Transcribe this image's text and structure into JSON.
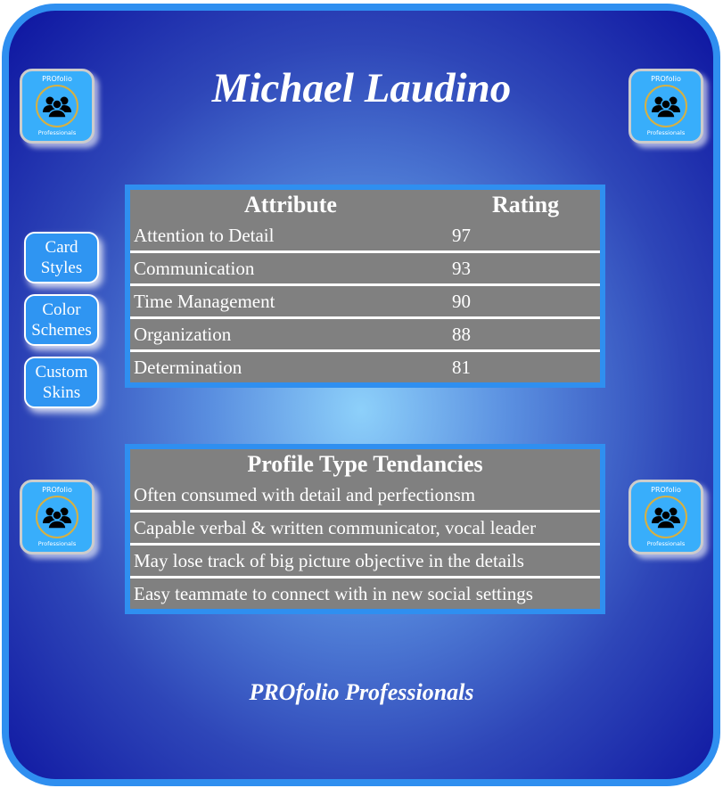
{
  "title": "Michael Laudino",
  "footer": "PROfolio Professionals",
  "logo": {
    "top": "PROfolio",
    "bottom": "Professionals"
  },
  "buttons": [
    {
      "line1": "Card",
      "line2": "Styles"
    },
    {
      "line1": "Color",
      "line2": "Schemes"
    },
    {
      "line1": "Custom",
      "line2": "Skins"
    }
  ],
  "attributes": {
    "headers": [
      "Attribute",
      "Rating"
    ],
    "rows": [
      {
        "name": "Attention to Detail",
        "rating": "97"
      },
      {
        "name": "Communication",
        "rating": "93"
      },
      {
        "name": "Time Management",
        "rating": "90"
      },
      {
        "name": "Organization",
        "rating": "88"
      },
      {
        "name": "Determination",
        "rating": "81"
      }
    ]
  },
  "tendencies": {
    "header": "Profile Type Tendancies",
    "rows": [
      "Often consumed with detail and perfectionsm",
      "Capable verbal & written communicator, vocal leader",
      "May lose track of big picture objective in the details",
      "Easy teammate to connect with in new social settings"
    ]
  },
  "colors": {
    "accent": "#2f8ff0",
    "table": "#808080"
  }
}
